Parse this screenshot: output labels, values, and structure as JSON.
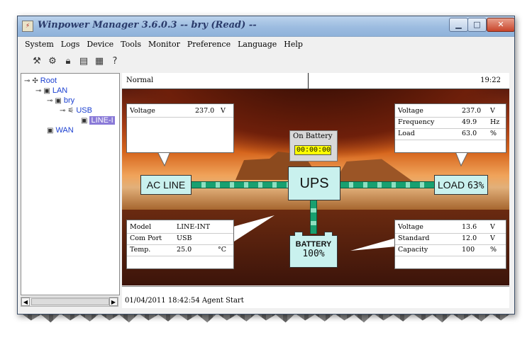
{
  "window": {
    "title": "Winpower Manager 3.6.0.3 -- bry (Read) --"
  },
  "window_controls": {
    "minimize": "▁",
    "maximize": "□",
    "close": "✕"
  },
  "menu": [
    "System",
    "Logs",
    "Device",
    "Tools",
    "Monitor",
    "Preference",
    "Language",
    "Help"
  ],
  "toolbar_icons": [
    "wrench-icon",
    "device-icon",
    "lock-icon",
    "monitor-icon",
    "calculator-icon",
    "help-icon"
  ],
  "tree": {
    "root": "Root",
    "lan": "LAN",
    "host": "bry",
    "usb": "USB",
    "line": "LINE-I",
    "wan": "WAN"
  },
  "status": {
    "state": "Normal",
    "time": "19:22"
  },
  "ac_panel": {
    "rows": [
      {
        "key": "Voltage",
        "value": "237.0",
        "unit": "V"
      }
    ]
  },
  "out_panel": {
    "rows": [
      {
        "key": "Voltage",
        "value": "237.0",
        "unit": "V"
      },
      {
        "key": "Frequency",
        "value": "49.9",
        "unit": "Hz"
      },
      {
        "key": "Load",
        "value": "63.0",
        "unit": "%"
      }
    ]
  },
  "model_panel": {
    "rows": [
      {
        "key": "Model",
        "value": "LINE-INT",
        "unit": ""
      },
      {
        "key": "Com Port",
        "value": "USB",
        "unit": ""
      },
      {
        "key": "Temp.",
        "value": "25.0",
        "unit": "°C"
      }
    ]
  },
  "bat_panel": {
    "rows": [
      {
        "key": "Voltage",
        "value": "13.6",
        "unit": "V"
      },
      {
        "key": "Standard",
        "value": "12.0",
        "unit": "V"
      },
      {
        "key": "Capacity",
        "value": "100",
        "unit": "%"
      }
    ]
  },
  "on_battery": {
    "label": "On Battery",
    "time": "00:00:00"
  },
  "diagram": {
    "ac_line": "AC LINE",
    "ups": "UPS",
    "load": "LOAD",
    "load_value": "63%",
    "battery": "BATTERY",
    "battery_value": "100%"
  },
  "log": {
    "entry": "01/04/2011 18:42:54  Agent Start"
  }
}
